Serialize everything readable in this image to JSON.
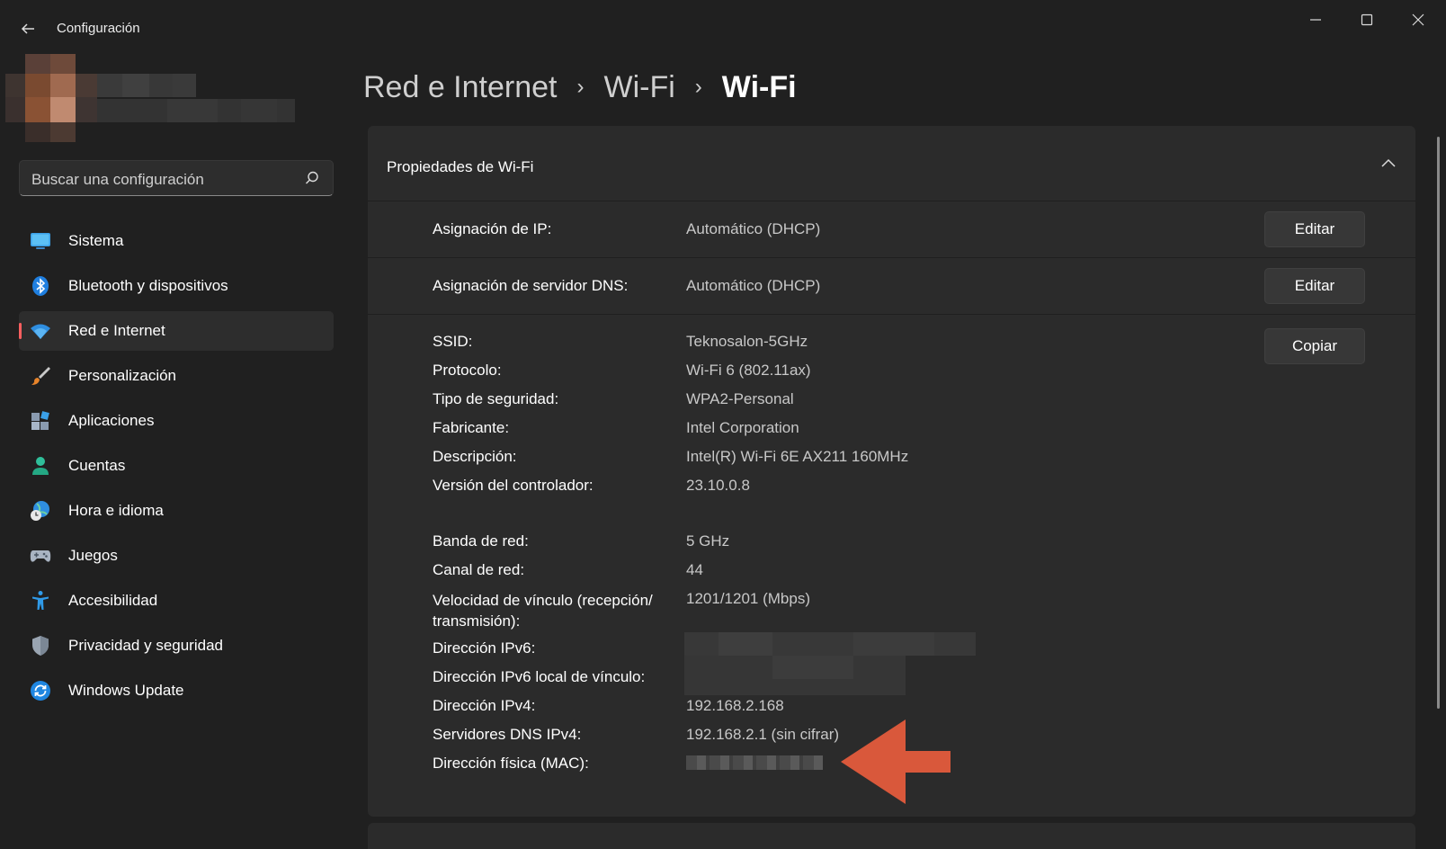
{
  "window": {
    "title": "Configuración",
    "back_icon": "arrow-left-icon",
    "minimize_icon": "minimize-icon",
    "maximize_icon": "maximize-icon",
    "close_icon": "close-icon"
  },
  "search": {
    "placeholder": "Buscar una configuración",
    "icon": "search-icon"
  },
  "sidebar": {
    "items": [
      {
        "label": "Sistema",
        "icon": "monitor-icon",
        "active": false
      },
      {
        "label": "Bluetooth y dispositivos",
        "icon": "bluetooth-icon",
        "active": false
      },
      {
        "label": "Red e Internet",
        "icon": "wifi-icon",
        "active": true
      },
      {
        "label": "Personalización",
        "icon": "brush-icon",
        "active": false
      },
      {
        "label": "Aplicaciones",
        "icon": "apps-icon",
        "active": false
      },
      {
        "label": "Cuentas",
        "icon": "person-icon",
        "active": false
      },
      {
        "label": "Hora e idioma",
        "icon": "globe-clock-icon",
        "active": false
      },
      {
        "label": "Juegos",
        "icon": "gamepad-icon",
        "active": false
      },
      {
        "label": "Accesibilidad",
        "icon": "accessibility-icon",
        "active": false
      },
      {
        "label": "Privacidad y seguridad",
        "icon": "shield-icon",
        "active": false
      },
      {
        "label": "Windows Update",
        "icon": "update-icon",
        "active": false
      }
    ],
    "accent_color": "#ff5f5f"
  },
  "breadcrumb": {
    "items": [
      "Red e Internet",
      "Wi-Fi",
      "Wi-Fi"
    ],
    "separator": "›"
  },
  "properties": {
    "title": "Propiedades de Wi-Fi",
    "ip_assignment": {
      "label": "Asignación de IP:",
      "value": "Automático (DHCP)",
      "button": "Editar"
    },
    "dns_assignment": {
      "label": "Asignación de servidor DNS:",
      "value": "Automático (DHCP)",
      "button": "Editar"
    },
    "copy_button": "Copiar",
    "details": [
      {
        "label": "SSID:",
        "value": "Teknosalon-5GHz"
      },
      {
        "label": "Protocolo:",
        "value": "Wi-Fi 6 (802.11ax)"
      },
      {
        "label": "Tipo de seguridad:",
        "value": "WPA2-Personal"
      },
      {
        "label": "Fabricante:",
        "value": "Intel Corporation"
      },
      {
        "label": "Descripción:",
        "value": "Intel(R) Wi-Fi 6E AX211 160MHz"
      },
      {
        "label": "Versión del controlador:",
        "value": "23.10.0.8"
      }
    ],
    "network": [
      {
        "label": "Banda de red:",
        "value": "5 GHz"
      },
      {
        "label": "Canal de red:",
        "value": "44"
      },
      {
        "label": "Velocidad de vínculo (recepción/ transmisión):",
        "value": "1201/1201 (Mbps)"
      },
      {
        "label": "Dirección IPv6:",
        "value": ""
      },
      {
        "label": "Dirección IPv6 local de vínculo:",
        "value": ""
      },
      {
        "label": "Dirección IPv4:",
        "value": "192.168.2.168"
      },
      {
        "label": "Servidores DNS IPv4:",
        "value": "192.168.2.1 (sin cifrar)"
      },
      {
        "label": "Dirección física (MAC):",
        "value": ""
      }
    ]
  },
  "annotation": {
    "icon": "arrow-left-icon",
    "color": "#d9583b"
  }
}
